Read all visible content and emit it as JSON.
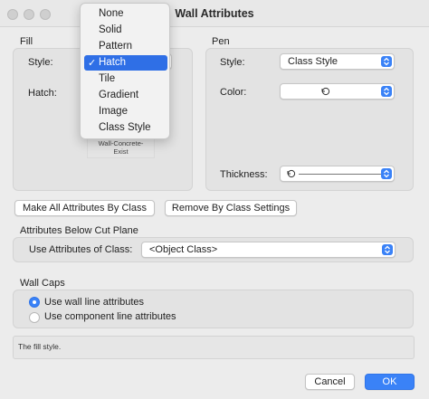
{
  "window": {
    "title": "Wall Attributes"
  },
  "fill": {
    "section_label": "Fill",
    "style_label": "Style:",
    "hatch_label": "Hatch:",
    "hatch_swatch_line1": "Wall-Concrete-",
    "hatch_swatch_line2": "Exist",
    "style_menu": {
      "options": [
        "None",
        "Solid",
        "Pattern",
        "Hatch",
        "Tile",
        "Gradient",
        "Image",
        "Class Style"
      ],
      "selected": "Hatch",
      "check_glyph": "✓"
    }
  },
  "pen": {
    "section_label": "Pen",
    "style_label": "Style:",
    "style_value": "Class Style",
    "color_label": "Color:",
    "thickness_label": "Thickness:"
  },
  "buttons": {
    "make_all": "Make All Attributes By Class",
    "remove_by_class": "Remove By Class Settings",
    "cancel": "Cancel",
    "ok": "OK"
  },
  "below_cut_plane": {
    "section_label": "Attributes Below Cut Plane",
    "use_attributes_label": "Use Attributes of Class:",
    "class_value": "<Object Class>"
  },
  "wall_caps": {
    "section_label": "Wall Caps",
    "options": [
      {
        "label": "Use wall line attributes",
        "selected": true
      },
      {
        "label": "Use component line attributes",
        "selected": false
      }
    ]
  },
  "description": "The fill style.",
  "colors": {
    "accent": "#3a82f7",
    "menu_highlight": "#2f6fe6",
    "background": "#ececec"
  },
  "icons": [
    "class-style-icon",
    "stepper-arrows-icon",
    "checkmark-icon"
  ]
}
